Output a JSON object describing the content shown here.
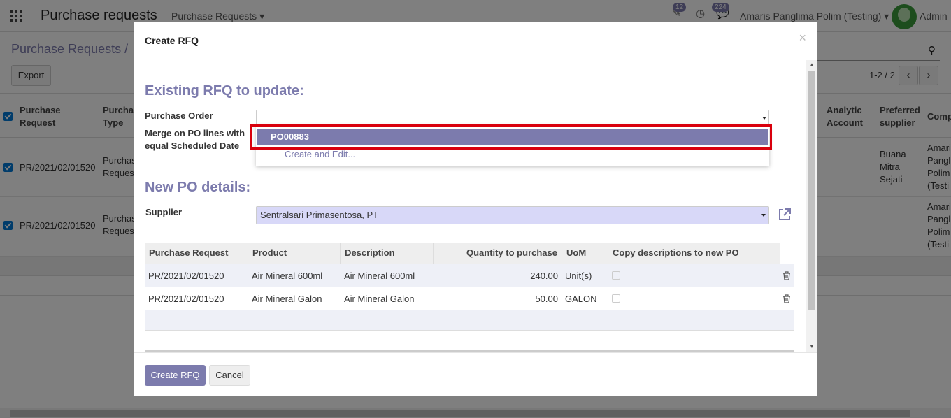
{
  "background": {
    "app_title": "Purchase requests",
    "menu": "Purchase Requests",
    "badges": {
      "activities": "12",
      "messages": "224"
    },
    "user": "Amaris Panglima Polim (Testing)",
    "admin": "Admin",
    "breadcrumb": "Purchase Requests /",
    "export_label": "Export",
    "pager": "1-2 / 2",
    "columns": {
      "purchase_request": "Purchase Request",
      "purchase_type": "Purcha Type",
      "analytic_account": "Analytic Account",
      "preferred_supplier": "Preferred supplier",
      "company": "Comp"
    },
    "rows": [
      {
        "request": "PR/2021/02/01520",
        "type": "Purchas Reques",
        "supplier": "Buana Mitra Sejati",
        "company": "Amari Pangl Polim (Testi"
      },
      {
        "request": "PR/2021/02/01520",
        "type": "Purchas Reques",
        "supplier": "",
        "company": "Amari Pangl Polim (Testi"
      }
    ]
  },
  "modal": {
    "title": "Create RFQ",
    "close": "×",
    "existing_section": "Existing RFQ to update:",
    "purchase_order_label": "Purchase Order",
    "purchase_order_value": "",
    "merge_label": "Merge on PO lines with equal Scheduled Date",
    "dropdown": {
      "option": "PO00883",
      "create_edit": "Create and Edit..."
    },
    "new_section": "New PO details:",
    "supplier_label": "Supplier",
    "supplier_value": "Sentralsari Primasentosa, PT",
    "table": {
      "headers": [
        "Purchase Request",
        "Product",
        "Description",
        "Quantity to purchase",
        "UoM",
        "Copy descriptions to new PO"
      ],
      "rows": [
        {
          "request": "PR/2021/02/01520",
          "product": "Air Mineral 600ml",
          "description": "Air Mineral 600ml",
          "qty": "240.00",
          "uom": "Unit(s)"
        },
        {
          "request": "PR/2021/02/01520",
          "product": "Air Mineral Galon",
          "description": "Air Mineral Galon",
          "qty": "50.00",
          "uom": "GALON"
        }
      ]
    },
    "create_button": "Create RFQ",
    "cancel_button": "Cancel"
  },
  "colors": {
    "accent": "#7c7bad",
    "highlight": "#d9000d",
    "checkbox": "#0078d7"
  }
}
